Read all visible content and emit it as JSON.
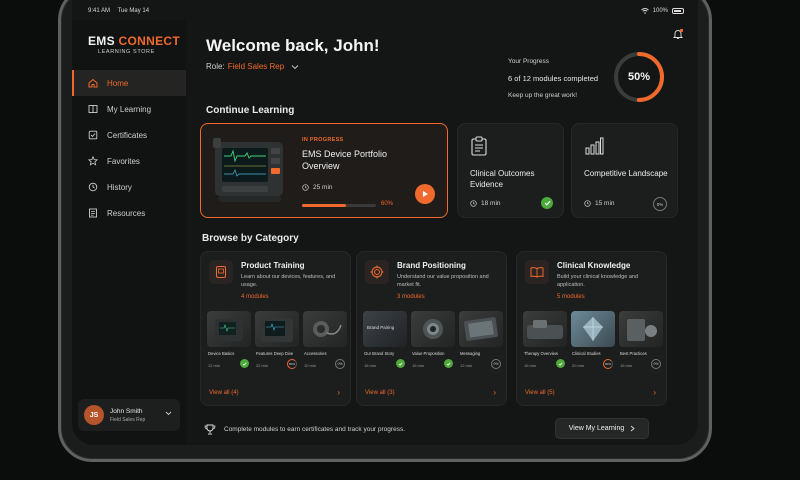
{
  "status": {
    "time": "9:41 AM",
    "date": "Tue May 14",
    "battery": "100%"
  },
  "logo": {
    "brand": "EMS",
    "brand_accent": "CONNECT",
    "subtitle": "LEARNING STORE"
  },
  "sidebar": {
    "items": [
      {
        "label": "Home",
        "icon": "home-icon",
        "active": true
      },
      {
        "label": "My Learning",
        "icon": "book-icon",
        "active": false
      },
      {
        "label": "Certificates",
        "icon": "certificate-icon",
        "active": false
      },
      {
        "label": "Favorites",
        "icon": "star-icon",
        "active": false
      },
      {
        "label": "History",
        "icon": "history-icon",
        "active": false
      },
      {
        "label": "Resources",
        "icon": "resources-icon",
        "active": false
      }
    ]
  },
  "user": {
    "initials": "JS",
    "name": "John Smith",
    "role": "Field Sales Rep"
  },
  "header": {
    "welcome": "Welcome back, John!",
    "role_label": "Role:",
    "role_value": "Field Sales Rep"
  },
  "progress": {
    "label": "Your Progress",
    "summary": "6 of 12 modules completed",
    "message": "Keep up the great work!",
    "percent_text": "50%",
    "percent": 50
  },
  "continue": {
    "title": "Continue Learning",
    "main": {
      "tag": "IN PROGRESS",
      "title": "EMS Device Portfolio Overview",
      "time": "25 min",
      "progress_text": "60%",
      "progress": 60
    },
    "cards": [
      {
        "title": "Clinical Outcomes Evidence",
        "time": "18 min",
        "status": "complete"
      },
      {
        "title": "Competitive Landscape",
        "time": "15 min",
        "status": "0%"
      }
    ]
  },
  "browse": {
    "title": "Browse by Category",
    "categories": [
      {
        "title": "Product Training",
        "desc": "Learn about our devices, features, and usage.",
        "modules": "4 modules",
        "view_all": "View all (4)",
        "thumbs": [
          {
            "label": "Device Basics",
            "time": "12 min",
            "status": "complete"
          },
          {
            "label": "Features Deep Dive",
            "time": "22 min",
            "status": "50%"
          },
          {
            "label": "Accessories",
            "time": "10 min",
            "status": "0%"
          }
        ]
      },
      {
        "title": "Brand Positioning",
        "desc": "Understand our value proposition and market fit.",
        "modules": "3 modules",
        "view_all": "View all (3)",
        "thumb_caption": "Brand Pairing",
        "thumbs": [
          {
            "label": "Our Brand Story",
            "time": "18 min",
            "status": "complete"
          },
          {
            "label": "Value Proposition",
            "time": "15 min",
            "status": "complete"
          },
          {
            "label": "Messaging",
            "time": "12 min",
            "status": "0%"
          }
        ]
      },
      {
        "title": "Clinical Knowledge",
        "desc": "Build your clinical knowledge and application.",
        "modules": "5 modules",
        "view_all": "View all (5)",
        "thumbs": [
          {
            "label": "Therapy Overview",
            "time": "16 min",
            "status": "complete"
          },
          {
            "label": "Clinical Studies",
            "time": "20 min",
            "status": "50%"
          },
          {
            "label": "Best Practices",
            "time": "15 min",
            "status": "0%"
          }
        ]
      }
    ]
  },
  "footer": {
    "text": "Complete modules to earn certificates and track your progress.",
    "button": "View My Learning"
  },
  "colors": {
    "accent": "#ef6a2c",
    "success": "#4da93a",
    "background": "#141615"
  }
}
